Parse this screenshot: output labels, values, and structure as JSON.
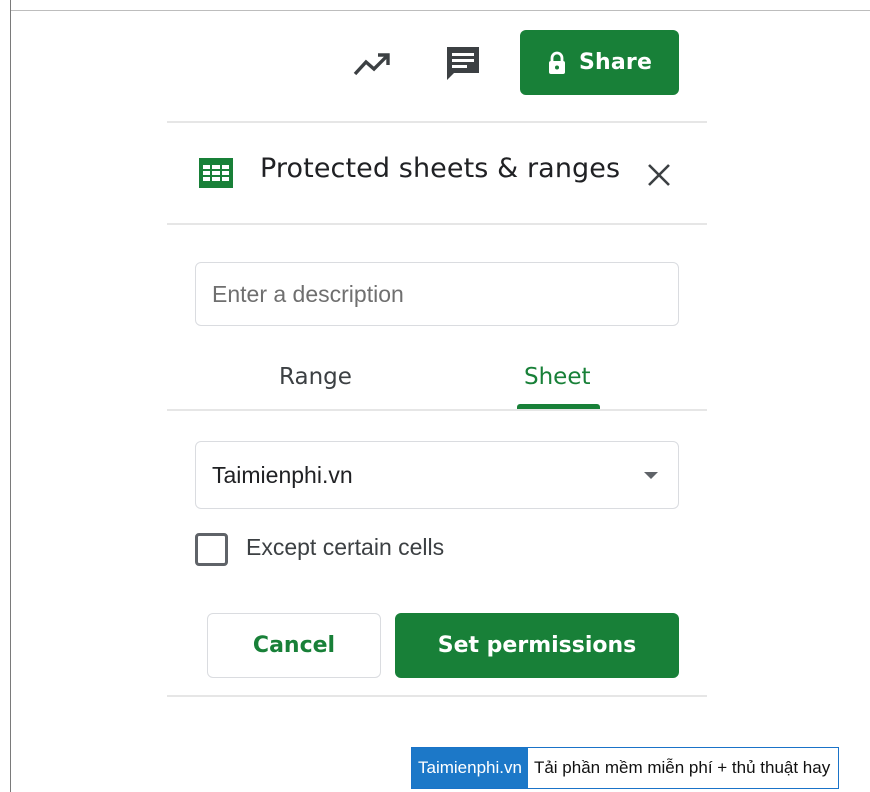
{
  "toolbar": {
    "share_label": "Share",
    "icons": [
      "trend-icon",
      "comment-icon",
      "lock-icon"
    ]
  },
  "panel": {
    "title": "Protected sheets & ranges",
    "description_placeholder": "Enter a description",
    "description_value": "",
    "tabs": [
      {
        "label": "Range",
        "active": false
      },
      {
        "label": "Sheet",
        "active": true
      }
    ],
    "sheet_select": {
      "selected": "Taimienphi.vn"
    },
    "except_cells": {
      "label": "Except certain cells",
      "checked": false
    },
    "cancel_label": "Cancel",
    "set_permissions_label": "Set permissions"
  },
  "watermark": {
    "brand": "Taimienphi.vn",
    "tagline": "Tải phần mềm miễn phí + thủ thuật hay"
  },
  "colors": {
    "accent_green": "#188038",
    "divider": "#e6e6e6",
    "watermark_blue": "#1c78c8"
  }
}
